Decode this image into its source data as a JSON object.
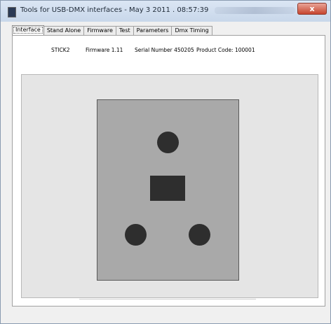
{
  "window": {
    "title": "Tools for USB-DMX interfaces - May  3 2011 . 08:57:39",
    "close_label": "x"
  },
  "tabs": [
    {
      "label": "Interface",
      "active": true
    },
    {
      "label": "Stand Alone",
      "active": false
    },
    {
      "label": "Firmware",
      "active": false
    },
    {
      "label": "Test",
      "active": false
    },
    {
      "label": "Parameters",
      "active": false
    },
    {
      "label": "Dmx Timing",
      "active": false
    }
  ],
  "device_info": {
    "model": "STICK2",
    "firmware": "Firmware 1.11",
    "serial": "Serial Number 450205",
    "product_code": "Product Code: 100001"
  },
  "colors": {
    "plug_body": "#a9a9a9",
    "pins": "#2e2e2e",
    "device_area": "#e5e5e5"
  },
  "icons": {
    "app": "app-window-icon"
  }
}
